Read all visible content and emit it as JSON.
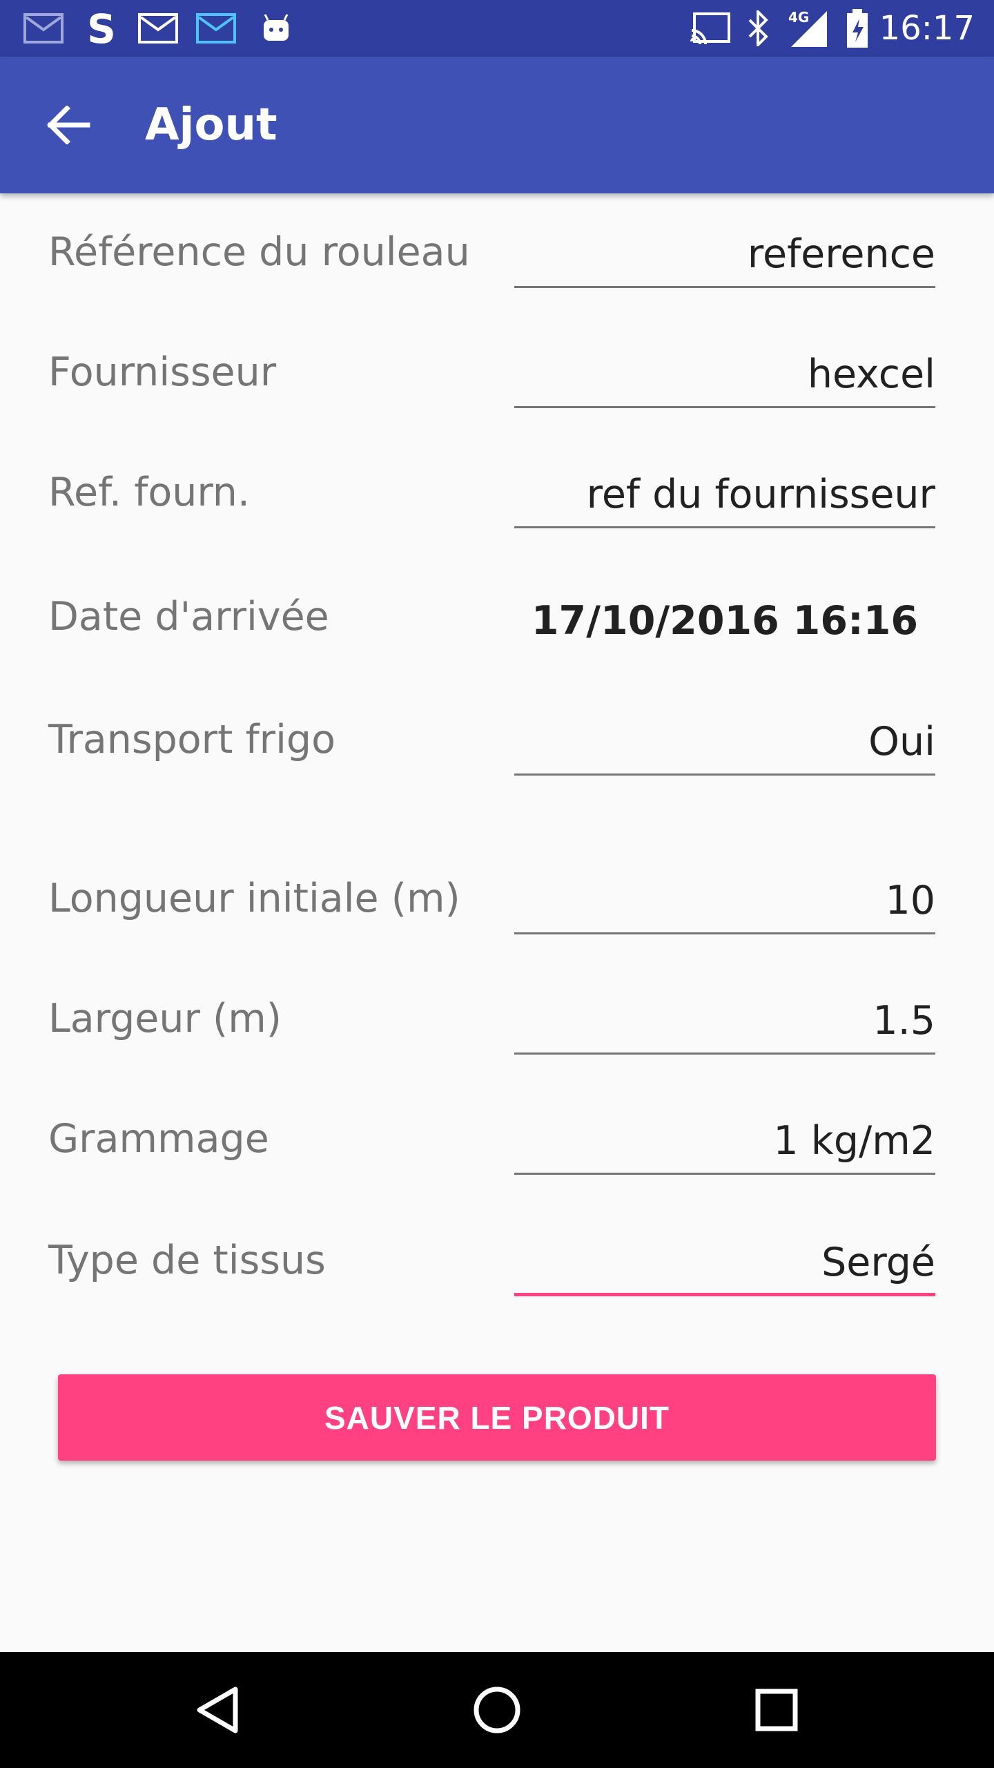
{
  "status_bar": {
    "time": "16:17",
    "network": "4G",
    "icons_left": [
      "mail-icon",
      "s-app-icon",
      "mail-icon",
      "mail-icon",
      "android-icon"
    ],
    "icons_right": [
      "cast-icon",
      "bluetooth-icon",
      "signal-icon",
      "battery-icon"
    ]
  },
  "app_bar": {
    "title": "Ajout"
  },
  "form": {
    "reference": {
      "label": "Référence du rouleau",
      "value": "reference"
    },
    "fournisseur": {
      "label": "Fournisseur",
      "value": "hexcel"
    },
    "ref_fourn": {
      "label": "Ref. fourn.",
      "value": "ref du fournisseur"
    },
    "date": {
      "label": "Date d'arrivée",
      "value": "17/10/2016 16:16"
    },
    "transport": {
      "label": "Transport frigo",
      "value": "Oui"
    },
    "longueur": {
      "label": "Longueur initiale (m)",
      "value": "10"
    },
    "largeur": {
      "label": "Largeur (m)",
      "value": "1.5"
    },
    "grammage": {
      "label": "Grammage",
      "value": "1 kg/m2"
    },
    "tissus": {
      "label": "Type de tissus",
      "value": "Sergé"
    }
  },
  "save_button": {
    "label": "SAUVER LE PRODUIT"
  },
  "colors": {
    "primary": "#3f51b5",
    "primary_dark": "#303f9f",
    "accent": "#ff4081"
  }
}
